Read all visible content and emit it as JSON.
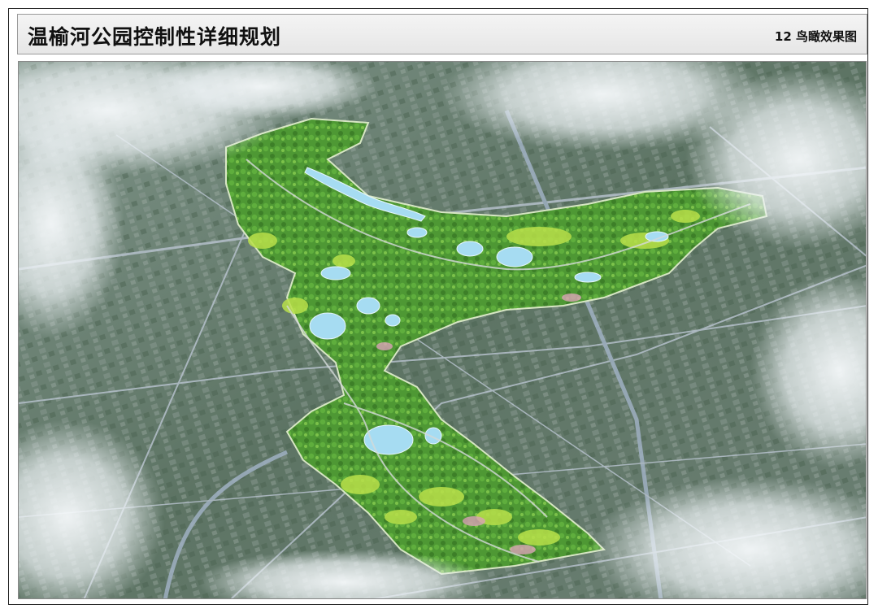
{
  "header": {
    "title": "温榆河公园控制性详细规划",
    "sheet_label": "12 鸟瞰效果图"
  },
  "colors": {
    "city_base": "#5f7566",
    "park_green": "#4f9a34",
    "park_light": "#b8df4a",
    "water": "#9fd8f0",
    "road": "#aeb8c4",
    "cloud": "#f4f7f9"
  }
}
